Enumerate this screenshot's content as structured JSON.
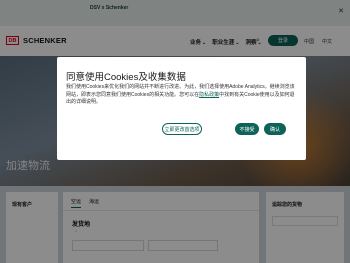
{
  "topbar": {
    "tag": "",
    "title": "DSV x Schenker",
    "text": "",
    "close_icon": "close-icon"
  },
  "header": {
    "logo_mark": "DB",
    "logo_name": "SCHENKER",
    "nav": [
      "业务",
      "职业生涯",
      "洞察"
    ],
    "search_icon": "search-icon",
    "login_label": "登录",
    "language": "中国",
    "region": "中文"
  },
  "hero": {
    "title": "加速物流"
  },
  "cards": {
    "quote_title": "现有客户",
    "tabs": [
      "空运",
      "海运"
    ],
    "ship_from_label": "发货地",
    "origin_placeholder": "",
    "destination_placeholder": "",
    "tracking_title": "追踪您的货物",
    "tracking_placeholder": ""
  },
  "dialog": {
    "title": "同意使用Cookies及收集数据",
    "body_part1": "我们使用Cookies来优化我们的网站并不断进行改进。为此，我们选择使用Adobe Analytics。继续浏览该网站，即表示您同意我们使用Cookies的相关功能。您可以在",
    "privacy_link": "隐私政策",
    "body_part2": "中找到有关Cookie使用以及如何退出的详细说明。",
    "settings_label": "立即更改首选项",
    "reject_label": "不接受",
    "accept_label": "确认"
  },
  "colors": {
    "accent": "#0e6358",
    "brand_red": "#e1001a"
  }
}
